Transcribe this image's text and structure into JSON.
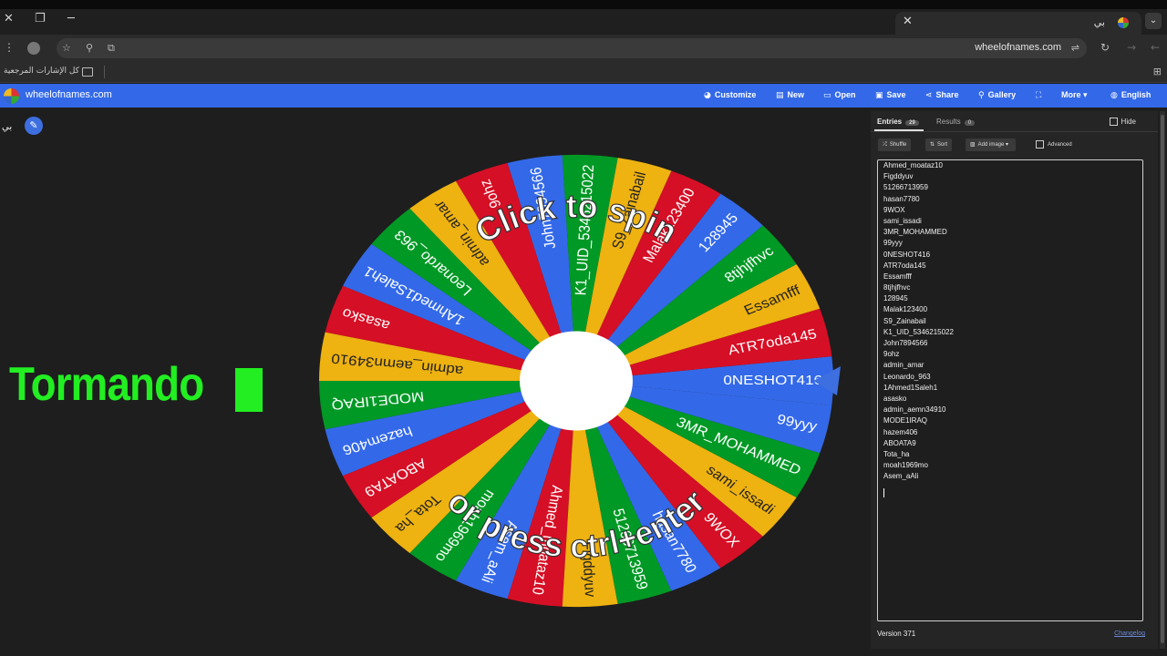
{
  "browser": {
    "tab_title": "بي",
    "url": "wheelofnames.com",
    "bookmarks_label": "كل الإشارات المرجعية"
  },
  "app": {
    "brand": "wheelofnames.com",
    "nav": [
      {
        "label": "Customize",
        "icon": "palette-icon"
      },
      {
        "label": "New",
        "icon": "new-file-icon"
      },
      {
        "label": "Open",
        "icon": "folder-icon"
      },
      {
        "label": "Save",
        "icon": "save-icon"
      },
      {
        "label": "Share",
        "icon": "share-icon"
      },
      {
        "label": "Gallery",
        "icon": "search-icon"
      },
      {
        "label": "",
        "icon": "fullscreen-icon"
      },
      {
        "label": "More",
        "icon": "chevron-down-icon"
      },
      {
        "label": "English",
        "icon": "globe-icon"
      }
    ],
    "user_label": "بي"
  },
  "overlay_text": "Tormando",
  "wheel": {
    "center_text_top": "Click to spin",
    "center_text_bottom": "or press ctrl+enter",
    "slices": [
      "0NESHOT416",
      "ATR7oda145",
      "Essamfff",
      "8tjhjfhvc",
      "128945",
      "Malak123400",
      "S9_Zainabail",
      "K1_UID_5346215022",
      "John7894566",
      "9ohz",
      "admin_amar",
      "Leonardo_963",
      "1Ahmed1Saleh1",
      "asasko",
      "admin_aemn34910",
      "MODE1IRAQ",
      "hazem406",
      "ABOATA9",
      "Tota_ha",
      "moah1969mo",
      "Asem_aAli",
      "Ahmed_moataz10",
      "Figddyuv",
      "51266713959",
      "hasan7780",
      "9WOX",
      "sami_issadi",
      "3MR_MOHAMMED",
      "99yyy"
    ],
    "colors": [
      "#3369e8",
      "#d50f25",
      "#eeb211",
      "#009925"
    ]
  },
  "panel": {
    "tab_entries": "Entries",
    "entries_count": "29",
    "tab_results": "Results",
    "results_count": "0",
    "hide_label": "Hide",
    "shuffle_label": "Shuffle",
    "sort_label": "Sort",
    "add_image_label": "Add image",
    "advanced_label": "Advanced",
    "entries": [
      "Ahmed_moataz10",
      "Figddyuv",
      "51266713959",
      "hasan7780",
      "9WOX",
      "sami_issadi",
      "3MR_MOHAMMED",
      "99yyy",
      "0NESHOT416",
      "ATR7oda145",
      "Essamfff",
      "8tjhjfhvc",
      "128945",
      "Malak123400",
      "S9_Zainabail",
      "K1_UID_5346215022",
      "John7894566",
      "9ohz",
      "admin_amar",
      "Leonardo_963",
      "1Ahmed1Saleh1",
      "asasko",
      "admin_aemn34910",
      "MODE1IRAQ",
      "hazem406",
      "ABOATA9",
      "Tota_ha",
      "moah1969mo",
      "Asem_aAli"
    ],
    "version": "Version 371",
    "changelog": "Changelog"
  }
}
